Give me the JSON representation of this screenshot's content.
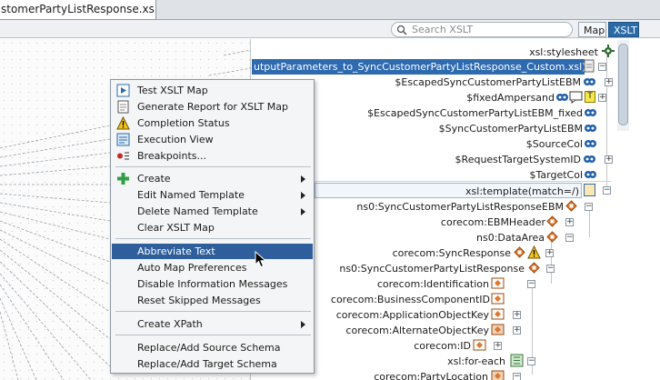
{
  "editor_tab": {
    "title": "stomerPartyListResponse.xsl"
  },
  "toolbar": {
    "search_placeholder": "Search XSLT",
    "mode_map": "Map",
    "mode_xslt": "XSLT"
  },
  "tree": {
    "stylesheet": "xsl:stylesheet",
    "selected_file": "utputParameters_to_SyncCustomerPartyListResponse_Custom.xsl)",
    "params": [
      "$EscapedSyncCustomerPartyListEBM",
      "$fixedAmpersand",
      "$EscapedSyncCustomerPartyListEBM_fixed",
      "$SyncCustomerPartyListEBM",
      "$SourceCol",
      "$RequestTargetSystemID",
      "$TargetCol"
    ],
    "template": "xsl:template(match=/)",
    "nodes": [
      "ns0:SyncCustomerPartyListResponseEBM",
      "corecom:EBMHeader",
      "ns0:DataArea",
      "corecom:SyncResponse",
      "ns0:SyncCustomerPartyListResponse",
      "corecom:Identification",
      "corecom:BusinessComponentID",
      "corecom:ApplicationObjectKey",
      "corecom:AlternateObjectKey",
      "corecom:ID",
      "xsl:for-each",
      "corecom:PartyLocation"
    ]
  },
  "context_menu": {
    "group1": [
      {
        "label": "Test XSLT Map",
        "icon": "test-map-icon"
      },
      {
        "label": "Generate Report for XSLT Map",
        "icon": "report-icon"
      },
      {
        "label": "Completion Status",
        "icon": "warning-icon"
      },
      {
        "label": "Execution View",
        "icon": "execution-view-icon"
      },
      {
        "label": "Breakpoints...",
        "icon": "breakpoints-icon"
      }
    ],
    "group2": [
      {
        "label": "Create",
        "icon": "plus-icon",
        "submenu": true
      },
      {
        "label": "Edit Named Template",
        "submenu": true
      },
      {
        "label": "Delete Named Template",
        "submenu": true
      },
      {
        "label": "Clear XSLT Map"
      }
    ],
    "group3": [
      {
        "label": "Abbreviate Text",
        "highlighted": true
      },
      {
        "label": "Auto Map Preferences"
      },
      {
        "label": "Disable Information Messages"
      },
      {
        "label": "Reset Skipped Messages"
      }
    ],
    "group4": [
      {
        "label": "Create XPath",
        "submenu": true
      }
    ],
    "group5": [
      {
        "label": "Replace/Add Source Schema"
      },
      {
        "label": "Replace/Add Target Schema"
      }
    ]
  },
  "colors": {
    "selection": "#2e6ab0",
    "menu_highlight": "#2e5f9c",
    "xslt_active": "#2a6aa6",
    "template_orange": "#e0772b"
  }
}
